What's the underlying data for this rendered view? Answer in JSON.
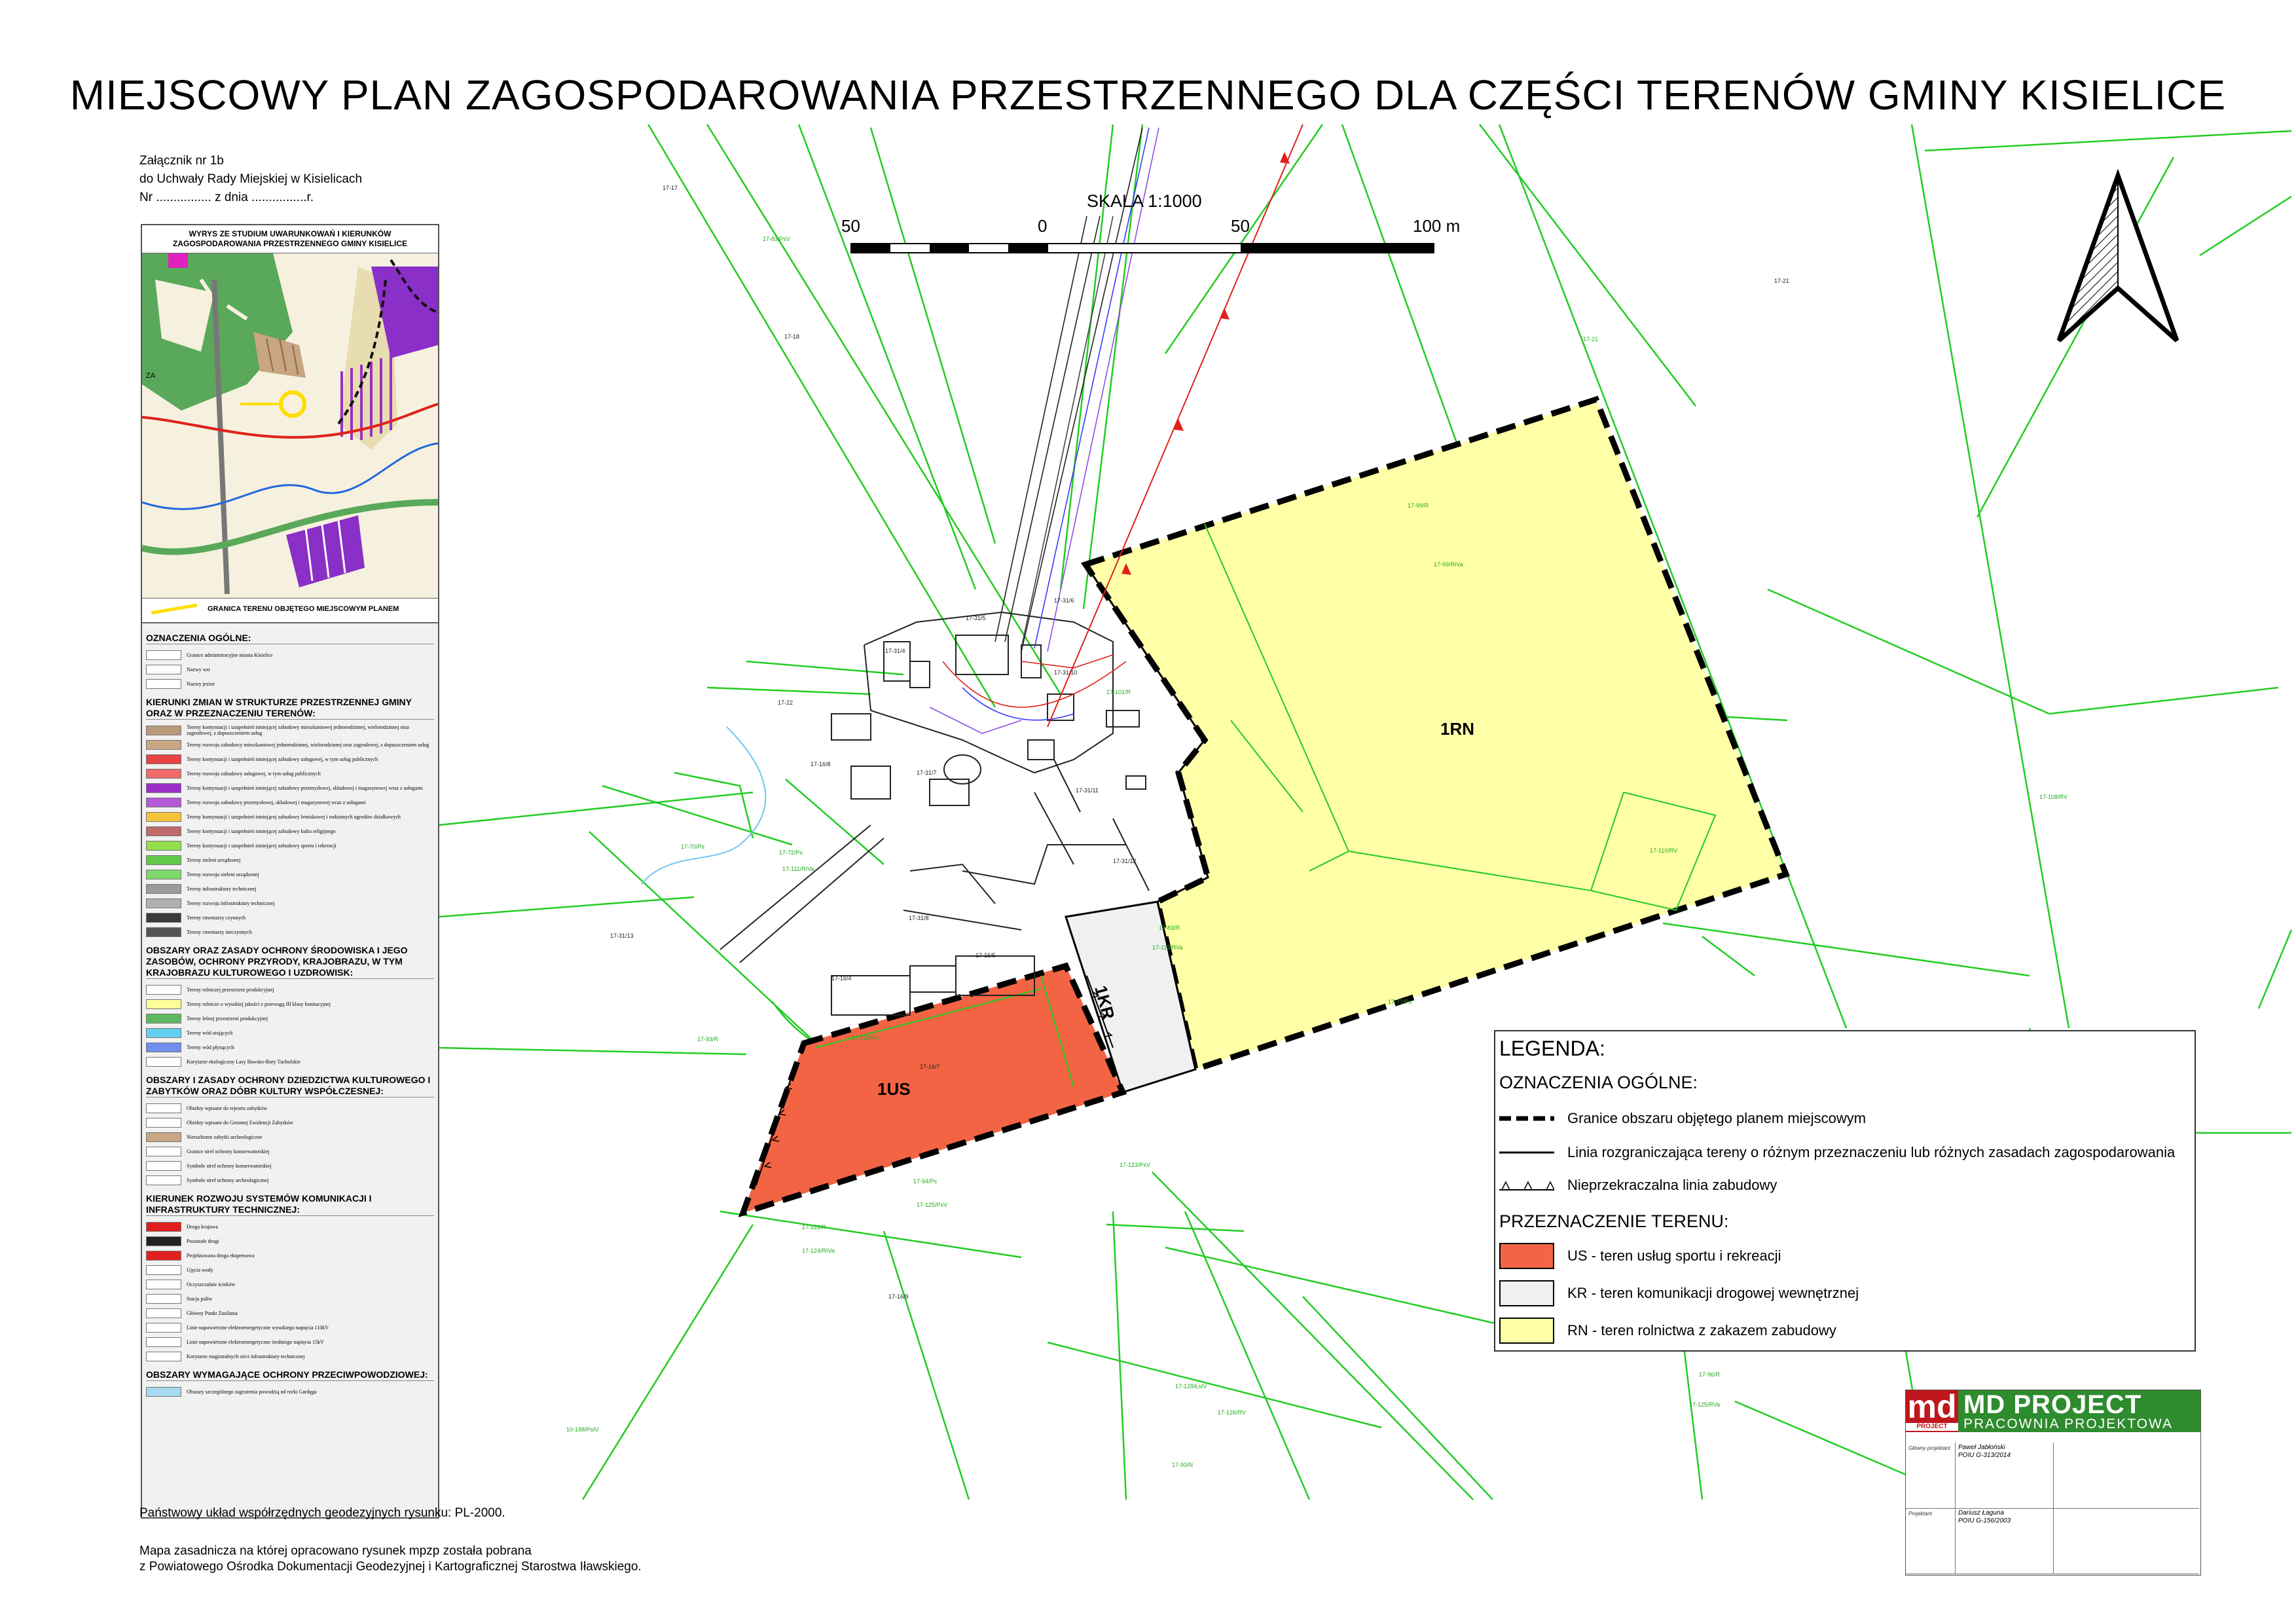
{
  "title": "MIEJSCOWY PLAN ZAGOSPODAROWANIA PRZESTRZENNEGO DLA CZĘŚCI TERENÓW GMINY KISIELICE",
  "annex": {
    "line1": "Załącznik nr 1b",
    "line2": "do Uchwały Rady Miejskiej w Kisielicach",
    "line3": "Nr ................ z dnia ................r."
  },
  "scale": {
    "title": "SKALA 1:1000",
    "ticks": [
      "50",
      "0",
      "50",
      "100 m"
    ]
  },
  "zones": {
    "rn": "1RN",
    "us": "1US",
    "kr": "1KR"
  },
  "colors": {
    "rn_fill": "#ffffa8",
    "us_fill": "#f26444",
    "kr_fill": "#f0f0f0",
    "parcel_line": "#22cc22",
    "power_line": "#e0211a"
  },
  "parcel_labels": [
    "17-17",
    "17-18",
    "17-21",
    "17-20",
    "17-22",
    "17-31/4",
    "17-31/5",
    "17-31/6",
    "17-31/10",
    "17-31/11",
    "17-31/12",
    "17-31/13",
    "17-16/4",
    "17-16/5",
    "17-16/7",
    "17-16/9",
    "17-16/10",
    "17-16/8",
    "17-31/7",
    "17-31/8",
    "17-31/9",
    "17-83/PsV",
    "17-99/R",
    "17-99/RIVa",
    "17-101/R",
    "17-110/RV",
    "17-108/RV",
    "17-77/Ps",
    "17-83/R",
    "17-113/RVa",
    "17-112/RV",
    "17-93/R",
    "17-94/Ps",
    "17-123/PsV",
    "17-122/R",
    "17-124/RIVa",
    "17-125/PsV",
    "17-126/RV",
    "17-128/ŁsIV",
    "17-93/N",
    "17-96/R",
    "17-125/RVa",
    "10-188/PsIV",
    "17-122/R",
    "17-70/Ps",
    "17-72/Ps",
    "17-111/RIVa"
  ],
  "study": {
    "header": "WYRYS ZE STUDIUM UWARUNKOWAŃ I KIERUNKÓW ZAGOSPODAROWANIA PRZESTRZENNEGO GMINY KISIELICE",
    "caption": "GRANICA TERENU OBJĘTEGO MIEJSCOWYM PLANEM",
    "sections": [
      {
        "title": "OZNACZENIA OGÓLNE:",
        "rows": [
          {
            "color": "#ffffff",
            "label": "Granice administracyjne miasta Kisielice"
          },
          {
            "color": "#ffffff",
            "label": "Nazwy wsi"
          },
          {
            "color": "#ffffff",
            "label": "Nazwy jezior"
          }
        ]
      },
      {
        "title": "KIERUNKI ZMIAN W STRUKTURZE PRZESTRZENNEJ GMINY ORAZ W PRZEZNACZENIU TERENÓW:",
        "rows": [
          {
            "color": "#b99a7a",
            "label": "Tereny kontynuacji i uzupełnień istniejącej zabudowy mieszkaniowej jednorodzinnej, wielorodzinnej oraz zagrodowej, z dopuszczeniem usług"
          },
          {
            "color": "#c8a583",
            "label": "Tereny rozwoju zabudowy mieszkaniowej jednorodzinnej, wielorodzinnej oraz zagrodowej, z dopuszczeniem usług"
          },
          {
            "color": "#e94444",
            "label": "Tereny kontynuacji i uzupełnień istniejącej zabudowy usługowej, w tym usług publicznych"
          },
          {
            "color": "#f06a6a",
            "label": "Tereny rozwoju zabudowy usługowej, w tym usług publicznych"
          },
          {
            "color": "#9b2fc8",
            "label": "Tereny kontynuacji i uzupełnień istniejącej zabudowy przemysłowej, składowej i magazynowej wraz z usługami"
          },
          {
            "color": "#b55ad8",
            "label": "Tereny rozwoju zabudowy przemysłowej, składowej i magazynowej wraz z usługami"
          },
          {
            "color": "#f5c33b",
            "label": "Tereny kontynuacji i uzupełnień istniejącej zabudowy letniskowej i rodzinnych ogrodów działkowych"
          },
          {
            "color": "#c06a6a",
            "label": "Tereny kontynuacji i uzupełnień istniejącej zabudowy kultu religijnego"
          },
          {
            "color": "#94e04c",
            "label": "Tereny kontynuacji i uzupełnień istniejącej zabudowy sportu i rekreacji"
          },
          {
            "color": "#62c94b",
            "label": "Tereny zieleni urządzonej"
          },
          {
            "color": "#7fd96a",
            "label": "Tereny rozwoju zieleni urządzonej"
          },
          {
            "color": "#9a9a9a",
            "label": "Tereny infrastruktury technicznej"
          },
          {
            "color": "#b0b0b0",
            "label": "Tereny rozwoju infrastruktury technicznej"
          },
          {
            "color": "#3a3a3a",
            "label": "Tereny cmentarzy czynnych"
          },
          {
            "color": "#555555",
            "label": "Tereny cmentarzy nieczynnych"
          }
        ]
      },
      {
        "title": "OBSZARY ORAZ ZASADY OCHRONY ŚRODOWISKA I JEGO ZASOBÓW, OCHRONY PRZYRODY, KRAJOBRAZU, W TYM KRAJOBRAZU KULTUROWEGO I UZDROWISK:",
        "rows": [
          {
            "color": "#ffffff",
            "label": "Tereny rolniczej przestrzeni produkcyjnej"
          },
          {
            "color": "#ffff99",
            "label": "Tereny rolnicze o wysokiej jakości z przewagą III klasy bonitacyjnej"
          },
          {
            "color": "#5fb85f",
            "label": "Tereny leśnej przestrzeni produkcyjnej"
          },
          {
            "color": "#63d0f0",
            "label": "Tereny wód stojących"
          },
          {
            "color": "#6f8ef0",
            "label": "Tereny wód płynących"
          },
          {
            "color": "#ffffff",
            "label": "Korytarze ekologiczny Lasy Iławsko-Bory Tucholskie"
          }
        ]
      },
      {
        "title": "OBSZARY I ZASADY OCHRONY DZIEDZICTWA KULTUROWEGO I ZABYTKÓW ORAZ DÓBR KULTURY WSPÓŁCZESNEJ:",
        "rows": [
          {
            "color": "#ffffff",
            "label": "Obiekty wpisane do rejestru zabytków"
          },
          {
            "color": "#ffffff",
            "label": "Obiekty wpisane do Gminnej Ewidencji Zabytków"
          },
          {
            "color": "#c8a583",
            "label": "Nieruchome zabytki archeologiczne"
          },
          {
            "color": "#ffffff",
            "label": "Granice stref ochrony konserwatorskiej"
          },
          {
            "color": "#ffffff",
            "label": "Symbole stref ochrony konserwatorskiej"
          },
          {
            "color": "#ffffff",
            "label": "Symbole stref ochrony archeologicznej"
          }
        ]
      },
      {
        "title": "KIERUNEK ROZWOJU SYSTEMÓW KOMUNIKACJI I INFRASTRUKTURY TECHNICZNEJ:",
        "rows": [
          {
            "color": "#e02020",
            "label": "Droga krajowa"
          },
          {
            "color": "#222222",
            "label": "Pozostałe drogi"
          },
          {
            "color": "#e02020",
            "label": "Projektowana droga ekspresowa"
          },
          {
            "color": "#ffffff",
            "label": "Ujęcia wody"
          },
          {
            "color": "#ffffff",
            "label": "Oczyszczalnie ścieków"
          },
          {
            "color": "#ffffff",
            "label": "Stacja paliw"
          },
          {
            "color": "#ffffff",
            "label": "Główny Punkt Zasilania"
          },
          {
            "color": "#ffffff",
            "label": "Linie napowietrzne elektroenergetyczne wysokiego napięcia 110kV"
          },
          {
            "color": "#ffffff",
            "label": "Linie napowietrzne elektroenergetyczne średniego napięcia 15kV"
          },
          {
            "color": "#ffffff",
            "label": "Korytarze magistralnych sieci infrastruktury technicznej"
          }
        ]
      },
      {
        "title": "OBSZARY WYMAGAJĄCE OCHRONY PRZECIWPOWODZIOWEJ:",
        "rows": [
          {
            "color": "#a6d9f2",
            "label": "Obszary szczególnego zagrożenia powodzią od rzeki Gardęga"
          }
        ]
      }
    ]
  },
  "legend": {
    "title": "LEGENDA:",
    "general_title": "OZNACZENIA OGÓLNE:",
    "boundary": "Granice obszaru objętego planem miejscowym",
    "divider": "Linia rozgraniczająca tereny o różnym przeznaczeniu lub różnych zasadach zagospodarowania",
    "building_line": "Nieprzekraczalna linia zabudowy",
    "purpose_title": "PRZEZNACZENIE TERENU:",
    "us": "US - teren usług sportu i rekreacji",
    "kr": "KR - teren komunikacji drogowej wewnętrznej",
    "rn": "RN - teren rolnictwa z zakazem zabudowy"
  },
  "footer": {
    "line1": "Państwowy układ współrzędnych geodezyjnych rysunku: PL-2000.",
    "line2": "Mapa zasadnicza na której opracowano rysunek mpzp została pobrana",
    "line3": "z Powiatowego Ośrodka Dokumentacji Geodezyjnej i Kartograficznej Starostwa Iławskiego."
  },
  "title_block": {
    "logo": "md",
    "logo_sub": "PROJECT",
    "company": "MD PROJECT",
    "subtitle": "PRACOWNIA PROJEKTOWA",
    "role1": "Główny projektant",
    "person1": "Paweł Jabłoński",
    "person1_id": "POIU G-313/2014",
    "role2": "Projektant",
    "person2": "Dariusz Łaguna",
    "person2_id": "POIU G-156/2003"
  }
}
